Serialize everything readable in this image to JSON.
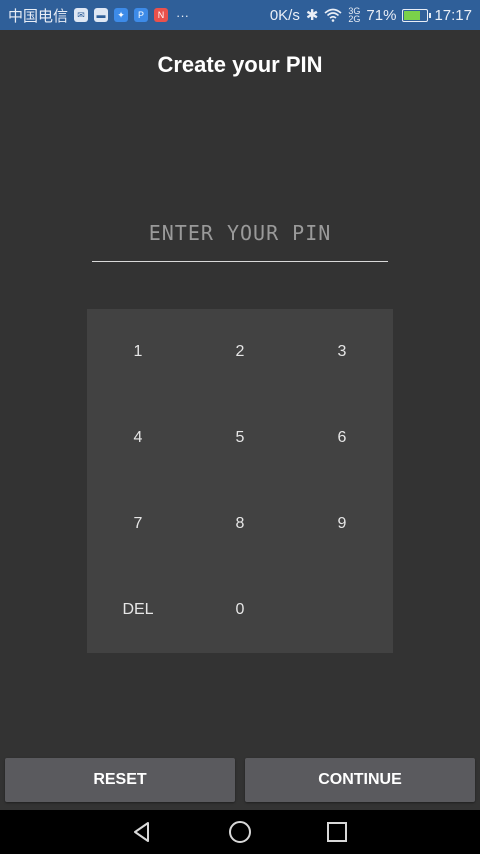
{
  "status_bar": {
    "carrier": "中国电信",
    "more": "···",
    "network_speed": "0K/s",
    "signal_labels": [
      "3G",
      "2G"
    ],
    "battery_percent_text": "71%",
    "battery_level": 0.71,
    "time": "17:17"
  },
  "title": "Create your PIN",
  "pin_input": {
    "value": "",
    "placeholder": "ENTER YOUR PIN"
  },
  "keypad": {
    "keys": [
      "1",
      "2",
      "3",
      "4",
      "5",
      "6",
      "7",
      "8",
      "9",
      "DEL",
      "0",
      ""
    ]
  },
  "buttons": {
    "reset": "RESET",
    "continue": "CONTINUE"
  },
  "colors": {
    "background": "#333333",
    "status_bar": "#2f5f99",
    "keypad": "#424242",
    "button": "#5a5a5e",
    "nav_bar": "#000000"
  }
}
